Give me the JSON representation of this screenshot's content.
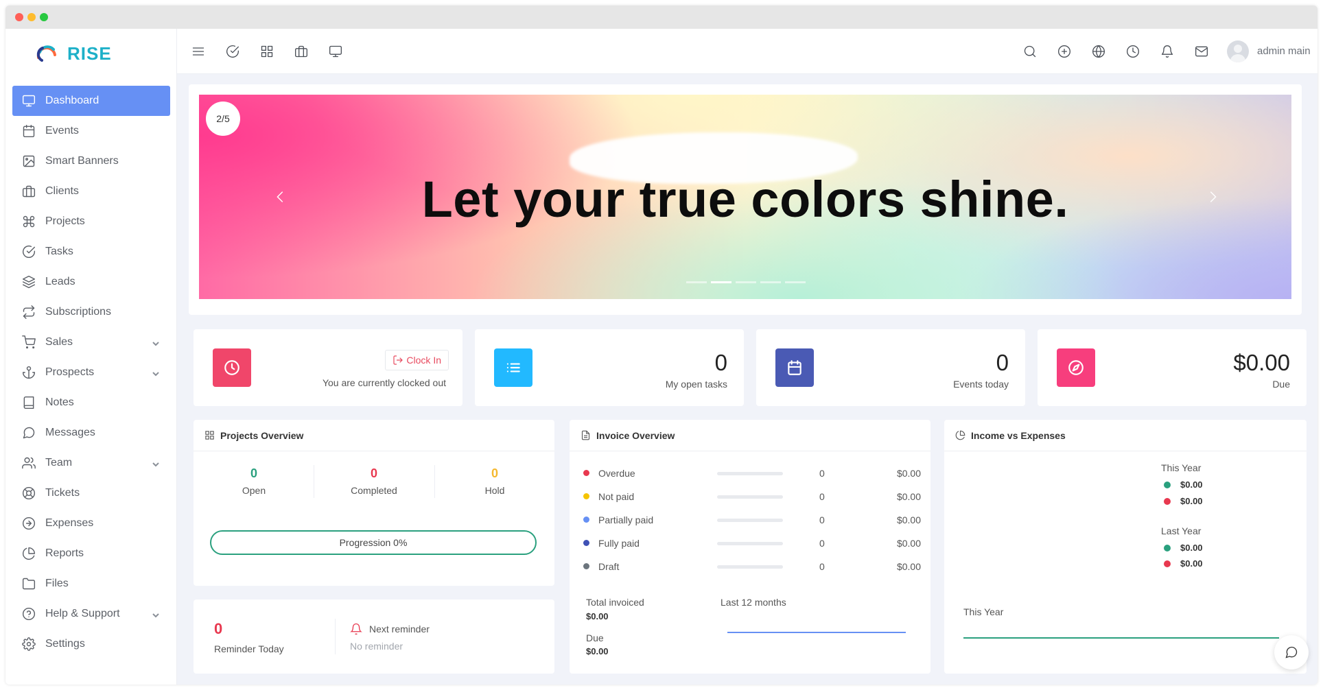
{
  "brand": {
    "name": "RISE"
  },
  "sidebar": {
    "items": [
      {
        "label": "Dashboard",
        "icon": "monitor-icon",
        "active": true
      },
      {
        "label": "Events",
        "icon": "calendar-icon"
      },
      {
        "label": "Smart Banners",
        "icon": "image-icon"
      },
      {
        "label": "Clients",
        "icon": "briefcase-icon"
      },
      {
        "label": "Projects",
        "icon": "command-icon"
      },
      {
        "label": "Tasks",
        "icon": "check-circle-icon"
      },
      {
        "label": "Leads",
        "icon": "layers-icon"
      },
      {
        "label": "Subscriptions",
        "icon": "repeat-icon"
      },
      {
        "label": "Sales",
        "icon": "cart-icon",
        "expandable": true
      },
      {
        "label": "Prospects",
        "icon": "anchor-icon",
        "expandable": true
      },
      {
        "label": "Notes",
        "icon": "book-icon"
      },
      {
        "label": "Messages",
        "icon": "message-circle-icon"
      },
      {
        "label": "Team",
        "icon": "users-icon",
        "expandable": true
      },
      {
        "label": "Tickets",
        "icon": "life-buoy-icon"
      },
      {
        "label": "Expenses",
        "icon": "arrow-right-circle-icon"
      },
      {
        "label": "Reports",
        "icon": "pie-chart-icon"
      },
      {
        "label": "Files",
        "icon": "folder-icon"
      },
      {
        "label": "Help & Support",
        "icon": "help-circle-icon",
        "expandable": true
      },
      {
        "label": "Settings",
        "icon": "settings-icon"
      }
    ]
  },
  "topbar": {
    "left_icons": [
      "menu-icon",
      "check-circle-icon",
      "grid-icon",
      "briefcase-icon",
      "monitor-icon"
    ],
    "right_icons": [
      "search-icon",
      "plus-circle-icon",
      "globe-icon",
      "clock-icon",
      "bell-icon",
      "mail-icon"
    ],
    "user_name": "admin main"
  },
  "banner": {
    "slide_counter": "2/5",
    "headline": "Let your true colors shine.",
    "slides_total": 5,
    "active_slide": 2
  },
  "stats": {
    "clock": {
      "button_label": "Clock In",
      "status": "You are currently clocked out",
      "color": "#f0466a"
    },
    "tasks": {
      "value": "0",
      "label": "My open tasks",
      "color": "#22b9ff"
    },
    "events": {
      "value": "0",
      "label": "Events today",
      "color": "#4a5ab4"
    },
    "due": {
      "value": "$0.00",
      "label": "Due",
      "color": "#f73e7d"
    }
  },
  "projects_overview": {
    "title": "Projects Overview",
    "columns": [
      {
        "value": "0",
        "label": "Open",
        "color": "#2aa07e"
      },
      {
        "value": "0",
        "label": "Completed",
        "color": "#e8384f"
      },
      {
        "value": "0",
        "label": "Hold",
        "color": "#f5b82e"
      }
    ],
    "progress_label": "Progression 0%",
    "progress": 0
  },
  "reminders": {
    "today_value": "0",
    "today_label": "Reminder Today",
    "next_label": "Next reminder",
    "next_value": "No reminder"
  },
  "invoice_overview": {
    "title": "Invoice Overview",
    "rows": [
      {
        "label": "Overdue",
        "count": "0",
        "amount": "$0.00",
        "color": "#e8384f"
      },
      {
        "label": "Not paid",
        "count": "0",
        "amount": "$0.00",
        "color": "#f5c400"
      },
      {
        "label": "Partially paid",
        "count": "0",
        "amount": "$0.00",
        "color": "#6690f4"
      },
      {
        "label": "Fully paid",
        "count": "0",
        "amount": "$0.00",
        "color": "#3f51b5"
      },
      {
        "label": "Draft",
        "count": "0",
        "amount": "$0.00",
        "color": "#6c757d"
      }
    ],
    "total_invoiced_label": "Total invoiced",
    "total_invoiced_value": "$0.00",
    "due_label": "Due",
    "due_value": "$0.00",
    "chart_label": "Last 12 months",
    "chart_color": "#6690f4"
  },
  "income_expenses": {
    "title": "Income vs Expenses",
    "this_year_label": "This Year",
    "this_year_income": "$0.00",
    "this_year_expense": "$0.00",
    "last_year_label": "Last Year",
    "last_year_income": "$0.00",
    "last_year_expense": "$0.00",
    "chart_label": "This Year",
    "income_color": "#2aa07e",
    "expense_color": "#e8384f"
  }
}
